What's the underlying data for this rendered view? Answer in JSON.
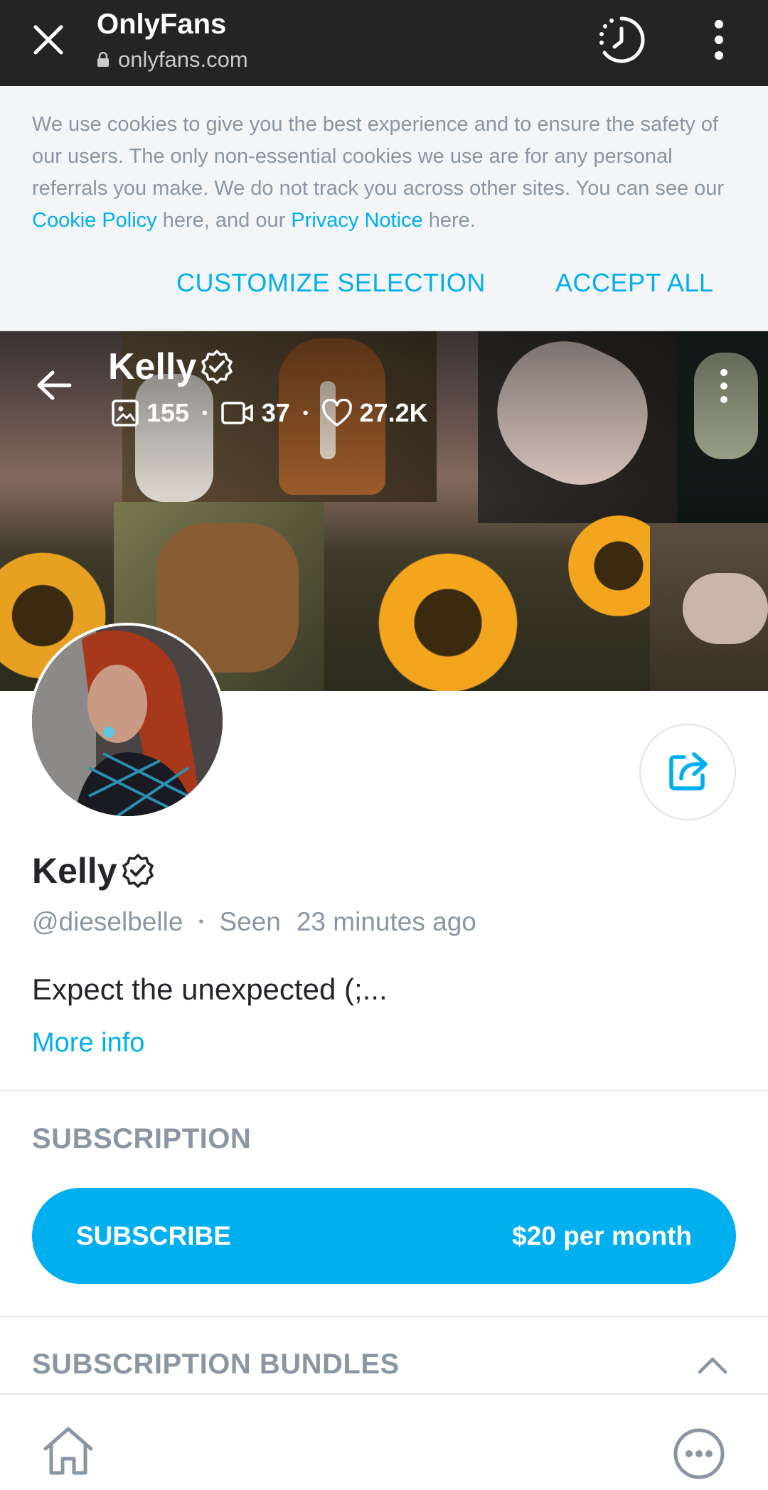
{
  "browser": {
    "title": "OnlyFans",
    "url": "onlyfans.com",
    "icons": [
      "close-icon",
      "lock-icon",
      "history-icon",
      "more-vert-icon"
    ]
  },
  "cookie_banner": {
    "text_part1": "We use cookies to give you the best experience and to ensure the safety of our users. The only non-essential cookies we use are for any personal referrals you make. We do not track you across other sites. You can see our ",
    "cookie_policy_link": "Cookie Policy",
    "text_part2": " here, and our ",
    "privacy_notice_link": "Privacy Notice",
    "text_part3": " here.",
    "customize_label": "CUSTOMIZE SELECTION",
    "accept_label": "ACCEPT ALL"
  },
  "cover": {
    "name": "Kelly",
    "stats": {
      "photos": "155",
      "videos": "37",
      "likes": "27.2K"
    },
    "icons": [
      "back-arrow-icon",
      "verified-icon",
      "image-icon",
      "video-icon",
      "heart-icon",
      "more-vert-icon"
    ]
  },
  "profile": {
    "name": "Kelly",
    "username": "@dieselbelle",
    "seen_label": "Seen",
    "seen_time": "23 minutes ago",
    "bio": "Expect the unexpected (;...",
    "more_info_label": "More info"
  },
  "subscription": {
    "section_title": "SUBSCRIPTION",
    "button_label": "SUBSCRIBE",
    "price": "$20 per month"
  },
  "bundles": {
    "section_title": "SUBSCRIPTION BUNDLES"
  },
  "bottom_nav": {
    "icons": [
      "home-icon",
      "more-horizontal-icon"
    ]
  },
  "colors": {
    "accent": "#00aff0",
    "muted_text": "#8a96a3",
    "primary_text": "#242529",
    "browser_bar": "#242424",
    "cookie_bg": "#f4f5f6"
  }
}
